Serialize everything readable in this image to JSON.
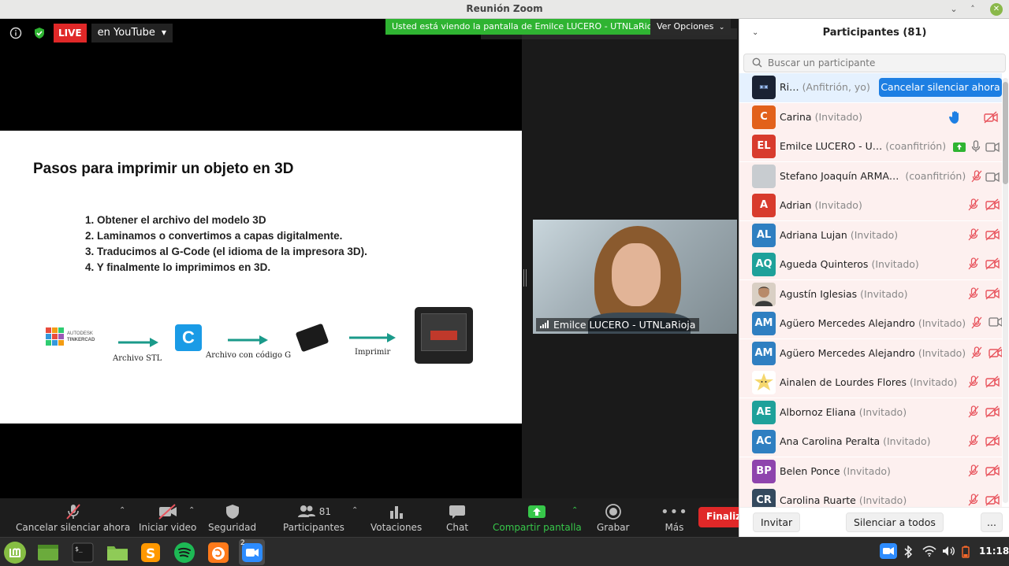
{
  "window": {
    "title": "Reunión Zoom"
  },
  "meeting": {
    "live_label": "LIVE",
    "stream_target": "en YouTube",
    "viewing_banner": "Usted está viendo la pantalla de Emilce LUCERO - UTNLaRioja",
    "view_options": "Ver Opciones",
    "camera_name": "Emilce LUCERO - UTNLaRioja"
  },
  "slide": {
    "title": "Pasos para imprimir un objeto en 3D",
    "steps": [
      "1. Obtener el archivo del modelo 3D",
      "2. Laminamos o convertimos a capas digitalmente.",
      "3. Traducimos al G-Code (el idioma de la impresora 3D).",
      "4. Y finalmente lo imprimimos en 3D."
    ],
    "brand_line1": "AUTODESK",
    "brand_line2": "TINKERCAD",
    "label_stl": "Archivo STL",
    "label_gcode": "Archivo con código G",
    "label_print": "Imprimir"
  },
  "toolbar": {
    "mute": "Cancelar silenciar ahora",
    "video": "Iniciar video",
    "security": "Seguridad",
    "participants": "Participantes",
    "participants_count": "81",
    "polls": "Votaciones",
    "chat": "Chat",
    "share": "Compartir pantalla",
    "record": "Grabar",
    "more": "Más",
    "end": "Finaliz"
  },
  "panel": {
    "title": "Participantes (81)",
    "search_placeholder": "Buscar un participante",
    "unmute_button": "Cancelar silenciar ahora",
    "invite": "Invitar",
    "mute_all": "Silenciar a todos",
    "more": "...",
    "participants": [
      {
        "initials": "",
        "name": "Ri…",
        "role": "(Anfitrión, yo)",
        "color": "#1a2233"
      },
      {
        "initials": "C",
        "name": "Carina",
        "role": "(Invitado)",
        "color": "#e2611b"
      },
      {
        "initials": "EL",
        "name": "Emilce LUCERO - U…",
        "role": "(coanfitrión)",
        "color": "#d83b2d"
      },
      {
        "initials": "",
        "name": "Stefano Joaquín ARMA…",
        "role": "(coanfitrión)",
        "color": "#c8ccd0"
      },
      {
        "initials": "A",
        "name": "Adrian",
        "role": "(Invitado)",
        "color": "#d83b2d"
      },
      {
        "initials": "AL",
        "name": "Adriana Lujan",
        "role": "(Invitado)",
        "color": "#2f7fc1"
      },
      {
        "initials": "AQ",
        "name": "Agueda Quinteros",
        "role": "(Invitado)",
        "color": "#1ea19a"
      },
      {
        "initials": "",
        "name": "Agustín Iglesias",
        "role": "(Invitado)",
        "color": "#8a7a6a"
      },
      {
        "initials": "AM",
        "name": "Agüero Mercedes Alejandro",
        "role": "(Invitado)",
        "color": "#2f7fc1"
      },
      {
        "initials": "AM",
        "name": "Agüero Mercedes Alejandro",
        "role": "(Invitado)",
        "color": "#2f7fc1"
      },
      {
        "initials": "",
        "name": "Ainalen de Lourdes Flores",
        "role": "(Invitado)",
        "color": "#f5d76e"
      },
      {
        "initials": "AE",
        "name": "Albornoz Eliana",
        "role": "(Invitado)",
        "color": "#1ea19a"
      },
      {
        "initials": "AC",
        "name": "Ana Carolina Peralta",
        "role": "(Invitado)",
        "color": "#2f7fc1"
      },
      {
        "initials": "BP",
        "name": "Belen Ponce",
        "role": "(Invitado)",
        "color": "#8e44ad"
      },
      {
        "initials": "CR",
        "name": "Carolina Ruarte",
        "role": "(Invitado)",
        "color": "#34495e"
      }
    ]
  },
  "taskbar": {
    "clock": "11:18",
    "zoom_badge": "2"
  },
  "colors": {
    "accent_blue": "#1d7fe3",
    "live_red": "#e02828",
    "share_green": "#37c74a",
    "muted_red": "#e8545d"
  }
}
